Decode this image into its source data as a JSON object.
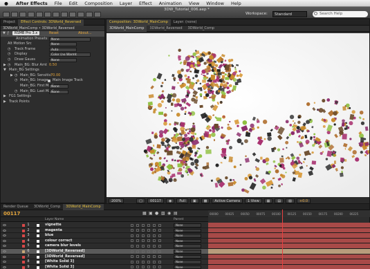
{
  "menubar": {
    "apple": "",
    "app_name": "After Effects",
    "items": [
      "File",
      "Edit",
      "Composition",
      "Layer",
      "Effect",
      "Animation",
      "View",
      "Window",
      "Help"
    ]
  },
  "toolbar": {
    "doc_title": "3DW_Tutorial_006.aep *",
    "workspace_label": "Workspace:",
    "workspace_value": "Standard",
    "search_placeholder": "Search Help"
  },
  "effect_controls": {
    "tabs": [
      "Project",
      "Effect Controls: 3DWorld_Reversed"
    ],
    "header": "3DWorld_MainComp • 3DWorld_Reversed",
    "effect_name": "RSMB Pro 3.x",
    "reset_label": "Reset",
    "about_label": "About...",
    "rows": [
      {
        "label": "Animation Presets:",
        "value": "None"
      },
      {
        "label": "Alt Motion Src",
        "value": "None"
      },
      {
        "label": "Track Frame",
        "value": "Auto"
      },
      {
        "label": "Display",
        "value": "Color (no Warmt"
      },
      {
        "label": "Draw Gauss",
        "value": "None"
      },
      {
        "label": "Main_BG: Blur Amt",
        "value": "0.50"
      },
      {
        "label": "Main_BG Settings",
        "value": ""
      },
      {
        "label": "Main_BG: Sensitiv",
        "value": "70.00"
      },
      {
        "label": "Main_BG: Image",
        "value": "Main Image Track"
      },
      {
        "label": "Main_BG: First Mask",
        "value": "None"
      },
      {
        "label": "Main_BG: Last Mask",
        "value": "None"
      },
      {
        "label": "FG1 Settings",
        "value": ""
      },
      {
        "label": "Track Points",
        "value": ""
      }
    ]
  },
  "composition": {
    "tabs": [
      "Composition: 3DWorld_MainComp",
      "Layer: (none)"
    ],
    "breadcrumbs": [
      "3DWorld_MainComp",
      "3DWorld_Reversed",
      "3DWorld_Comp"
    ],
    "footer": {
      "zoom": "200%",
      "timecode": "00117",
      "resolution": "Full",
      "camera": "Active Camera",
      "views": "1 View",
      "exposure": "+0.0"
    }
  },
  "timeline": {
    "tabs": [
      "Render Queue",
      "3DWorld_Comp",
      "3DWorld_MainComp"
    ],
    "current_time": "00117",
    "ruler_ticks": [
      "00000",
      "00025",
      "00050",
      "00075",
      "00100",
      "00125",
      "00150",
      "00175",
      "00200",
      "00225"
    ],
    "column_header": "Layer Name",
    "parent_header": "Parent",
    "layers": [
      {
        "num": "1",
        "name": "vignette",
        "parent": "None",
        "label_color": "#d84848",
        "selected": false
      },
      {
        "num": "2",
        "name": "magenta",
        "parent": "None",
        "label_color": "#d84848",
        "selected": false
      },
      {
        "num": "3",
        "name": "blue",
        "parent": "None",
        "label_color": "#d84848",
        "selected": false
      },
      {
        "num": "4",
        "name": "colour correct",
        "parent": "None",
        "label_color": "#d84848",
        "selected": false
      },
      {
        "num": "5",
        "name": "camera blur levels",
        "parent": "None",
        "label_color": "#d84848",
        "selected": false
      },
      {
        "num": "6",
        "name": "[3DWorld_Reversed]",
        "parent": "None",
        "label_color": "#c8a878",
        "selected": true
      },
      {
        "num": "7",
        "name": "[3DWorld_Reversed]",
        "parent": "None",
        "label_color": "#d84848",
        "selected": false
      },
      {
        "num": "8",
        "name": "[White Solid 3]",
        "parent": "None",
        "label_color": "#d84848",
        "selected": false
      },
      {
        "num": "9",
        "name": "[White Solid 3]",
        "parent": "None",
        "label_color": "#d84848",
        "selected": false
      }
    ]
  },
  "colors": {
    "accent": "#e5a53a",
    "bar_red": "#a84a48",
    "bar_tan": "#b89c7c",
    "playhead": "#e94040"
  }
}
